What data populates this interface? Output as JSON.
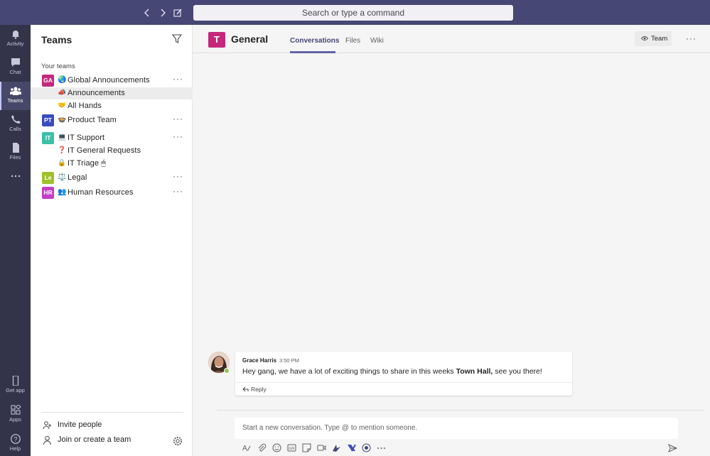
{
  "topbar": {
    "search_placeholder": "Search or type a command"
  },
  "rail": {
    "items": [
      {
        "label": "Activity",
        "icon": "bell-icon"
      },
      {
        "label": "Chat",
        "icon": "chat-icon"
      },
      {
        "label": "Teams",
        "icon": "teams-icon",
        "active": true
      },
      {
        "label": "Calls",
        "icon": "phone-icon"
      },
      {
        "label": "Files",
        "icon": "file-icon"
      },
      {
        "label": "",
        "icon": "more-apps-icon"
      }
    ],
    "bottom": [
      {
        "label": "Get app",
        "icon": "mobile-icon"
      },
      {
        "label": "Apps",
        "icon": "apps-icon"
      },
      {
        "label": "Help",
        "icon": "help-icon"
      }
    ]
  },
  "pane": {
    "title": "Teams",
    "section_label": "Your teams",
    "teams": [
      {
        "initials": "GA",
        "color": "#c4287c",
        "emoji": "🌏",
        "name": "Global Announcements",
        "channels": [
          {
            "emoji": "📣",
            "name": "Announcements",
            "selected": true
          },
          {
            "emoji": "🤝",
            "name": "All Hands"
          }
        ]
      },
      {
        "initials": "PT",
        "color": "#3a4dbe",
        "emoji": "🍲",
        "name": "Product Team",
        "channels": []
      },
      {
        "initials": "IT",
        "color": "#3bbfa6",
        "emoji": "💻",
        "name": "IT Support",
        "channels": [
          {
            "emoji": "❓",
            "name": "IT General Requests"
          },
          {
            "emoji": "🔒",
            "name": "IT Triage 🖱"
          }
        ]
      },
      {
        "initials": "Le",
        "color": "#9ec12a",
        "emoji": "⚖️",
        "name": "Legal",
        "channels": []
      },
      {
        "initials": "HR",
        "color": "#c43ec6",
        "emoji": "👥",
        "name": "Human Resources",
        "channels": []
      }
    ],
    "more_glyph": "···",
    "invite_label": "Invite people",
    "join_label": "Join or create a team"
  },
  "header": {
    "avatar_letter": "T",
    "channel_title": "General",
    "tabs": [
      "Conversations",
      "Files",
      "Wiki"
    ],
    "active_tab": 0,
    "team_button_label": "Team",
    "more_glyph": "···"
  },
  "message": {
    "author": "Grace Harris",
    "time": "3:50 PM",
    "body_before": "Hey gang, we have a lot of exciting things to share in this weeks ",
    "body_bold": "Town Hall,",
    "body_after": " see you there!",
    "reply_label": "Reply"
  },
  "compose": {
    "placeholder": "Start a new conversation. Type @ to mention someone.",
    "toolbar_icons": [
      "format-icon",
      "attach-icon",
      "emoji-icon",
      "gif-icon",
      "sticker-icon",
      "meet-now-icon",
      "stream-icon",
      "flow-icon",
      "praise-icon",
      "more-icon"
    ]
  }
}
